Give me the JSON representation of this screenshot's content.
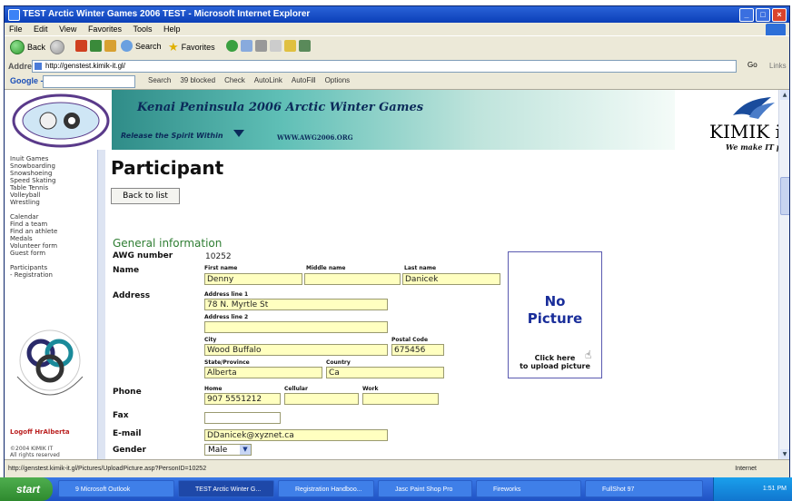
{
  "window": {
    "title": "TEST Arctic Winter Games 2006 TEST - Microsoft Internet Explorer"
  },
  "menu": [
    "File",
    "Edit",
    "View",
    "Favorites",
    "Tools",
    "Help"
  ],
  "toolbar": {
    "back": "Back",
    "search": "Search",
    "favorites": "Favorites"
  },
  "address": {
    "label": "Address",
    "url": "http://genstest.kimik-it.gl/",
    "go": "Go",
    "links": "Links"
  },
  "google": {
    "logo": "Google -",
    "search": "Search",
    "blocked": "39 blocked",
    "check": "Check",
    "autolink": "AutoLink",
    "autofill": "AutoFill",
    "options": "Options"
  },
  "banner": {
    "title": "Kenai Peninsula 2006 Arctic Winter Games",
    "slogan": "Release the Spirit Within",
    "url": "WWW.AWG2006.ORG"
  },
  "kimik": {
    "name": "KIMIK iT",
    "tagline": "We make IT possible"
  },
  "sidebar": {
    "items": [
      "Inuit Games",
      "Snowboarding",
      "Snowshoeing",
      "Speed Skating",
      "Table Tennis",
      "Volleyball",
      "Wrestling"
    ],
    "items2": [
      "Calendar",
      "Find a team",
      "Find an athlete",
      "Medals",
      "Volunteer form",
      "Guest form"
    ],
    "items3": [
      "Participants",
      "- Registration"
    ],
    "logoff": "Logoff HrAlberta",
    "copyright1": "©2004 KIMIK IT",
    "copyright2": "All rights reserved"
  },
  "page": {
    "title": "Participant",
    "back": "Back to list",
    "section": "General information",
    "awg_label": "AWG number",
    "awg_value": "10252",
    "name_label": "Name",
    "first_label": "First name",
    "first_value": "Denny",
    "middle_label": "Middle name",
    "middle_value": "",
    "last_label": "Last name",
    "last_value": "Danicek",
    "address_label": "Address",
    "addr1_label": "Address line 1",
    "addr1_value": "78 N. Myrtle St",
    "addr2_label": "Address line 2",
    "addr2_value": "",
    "city_label": "City",
    "city_value": "Wood Buffalo",
    "postal_label": "Postal Code",
    "postal_value": "675456",
    "state_label": "State/Province",
    "state_value": "Alberta",
    "country_label": "Country",
    "country_value": "Ca",
    "phone_label": "Phone",
    "home_label": "Home",
    "home_value": "907 5551212",
    "cell_label": "Cellular",
    "cell_value": "",
    "work_label": "Work",
    "work_value": "",
    "fax_label": "Fax",
    "fax_value": "",
    "email_label": "E-mail",
    "email_value": "DDanicek@xyznet.ca",
    "gender_label": "Gender",
    "gender_value": "Male",
    "picture_line1": "No",
    "picture_line2": "Picture",
    "upload_line1": "Click here",
    "upload_line2": "to upload picture"
  },
  "status": {
    "url": "http://genstest.kimik-it.gl/Pictures/UploadPicture.asp?PersonID=10252",
    "zone": "Internet"
  },
  "taskbar": {
    "start": "start",
    "tasks": [
      "9 Microsoft Outlook",
      "TEST Arctic Winter G...",
      "Registration Handboo...",
      "Jasc Paint Shop Pro",
      "Fireworks",
      "FullShot 97"
    ],
    "clock": "1:51 PM"
  }
}
